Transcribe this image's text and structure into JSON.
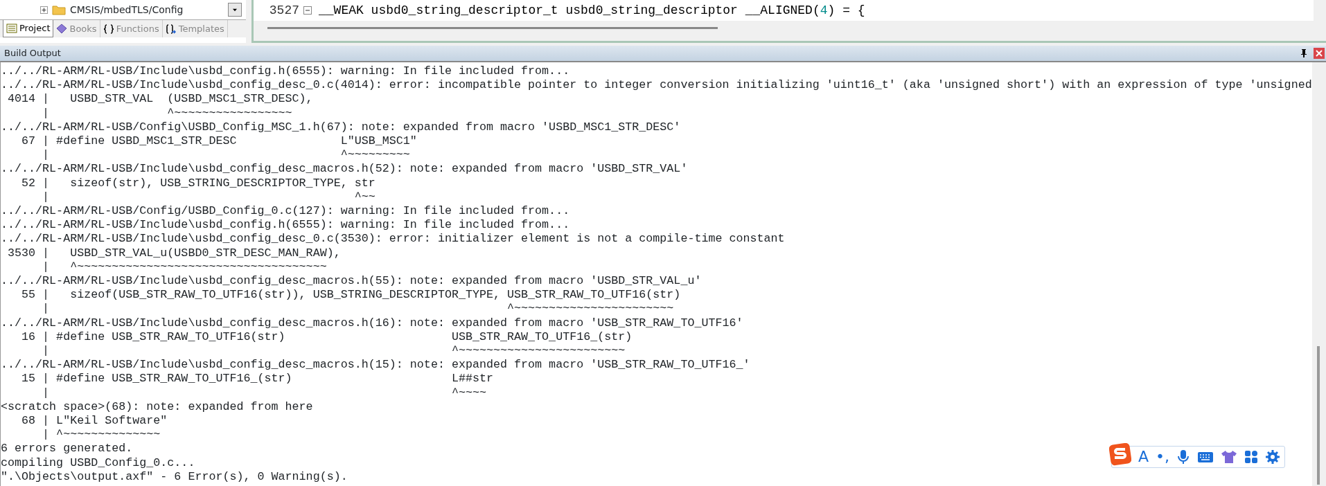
{
  "project_panel": {
    "tree_item": {
      "label": "CMSIS/mbedTLS/Config",
      "expanded": false
    },
    "tabs": [
      {
        "label": "Project",
        "kind": "project",
        "selected": true
      },
      {
        "label": "Books",
        "kind": "books",
        "selected": false
      },
      {
        "label": "Functions",
        "kind": "functions",
        "selected": false
      },
      {
        "label": "Templates",
        "kind": "templates",
        "selected": false
      }
    ]
  },
  "editor": {
    "line_number": "3527",
    "tokens": [
      {
        "text": "__WEAK usbd0_string_descriptor_t usbd0_string_descriptor __ALIGNED(",
        "kind": "plain"
      },
      {
        "text": "4",
        "kind": "number"
      },
      {
        "text": ") = {",
        "kind": "plain"
      }
    ]
  },
  "build_output": {
    "title": "Build Output",
    "lines": [
      "../../RL-ARM/RL-USB/Include\\usbd_config.h(6555): warning: In file included from...",
      "../../RL-ARM/RL-USB/Include\\usbd_config_desc_0.c(4014): error: incompatible pointer to integer conversion initializing 'uint16_t' (aka 'unsigned short') with an expression of type 'unsigned",
      " 4014 |   USBD_STR_VAL  (USBD_MSC1_STR_DESC),",
      "      |                 ^~~~~~~~~~~~~~~~~~",
      "../../RL-ARM/RL-USB/Config\\USBD_Config_MSC_1.h(67): note: expanded from macro 'USBD_MSC1_STR_DESC'",
      "   67 | #define USBD_MSC1_STR_DESC               L\"USB_MSC1\"",
      "      |                                          ^~~~~~~~~~",
      "../../RL-ARM/RL-USB/Include\\usbd_config_desc_macros.h(52): note: expanded from macro 'USBD_STR_VAL'",
      "   52 |   sizeof(str), USB_STRING_DESCRIPTOR_TYPE, str",
      "      |                                            ^~~",
      "../../RL-ARM/RL-USB/Config/USBD_Config_0.c(127): warning: In file included from...",
      "../../RL-ARM/RL-USB/Include\\usbd_config.h(6555): warning: In file included from...",
      "../../RL-ARM/RL-USB/Include\\usbd_config_desc_0.c(3530): error: initializer element is not a compile-time constant",
      " 3530 |   USBD_STR_VAL_u(USBD0_STR_DESC_MAN_RAW),",
      "      |   ^~~~~~~~~~~~~~~~~~~~~~~~~~~~~~~~~~~~~",
      "../../RL-ARM/RL-USB/Include\\usbd_config_desc_macros.h(55): note: expanded from macro 'USBD_STR_VAL_u'",
      "   55 |   sizeof(USB_STR_RAW_TO_UTF16(str)), USB_STRING_DESCRIPTOR_TYPE, USB_STR_RAW_TO_UTF16(str)",
      "      |                                                                  ^~~~~~~~~~~~~~~~~~~~~~~~",
      "../../RL-ARM/RL-USB/Include\\usbd_config_desc_macros.h(16): note: expanded from macro 'USB_STR_RAW_TO_UTF16'",
      "   16 | #define USB_STR_RAW_TO_UTF16(str)                        USB_STR_RAW_TO_UTF16_(str)",
      "      |                                                          ^~~~~~~~~~~~~~~~~~~~~~~~~",
      "../../RL-ARM/RL-USB/Include\\usbd_config_desc_macros.h(15): note: expanded from macro 'USB_STR_RAW_TO_UTF16_'",
      "   15 | #define USB_STR_RAW_TO_UTF16_(str)                       L##str",
      "      |                                                          ^~~~~",
      "<scratch space>(68): note: expanded from here",
      "   68 | L\"Keil Software\"",
      "      | ^~~~~~~~~~~~~~~",
      "6 errors generated.",
      "compiling USBD_Config_0.c...",
      "\".\\Objects\\output.axf\" - 6 Error(s), 0 Warning(s)."
    ]
  },
  "ime_toolbar": {
    "items": [
      {
        "kind": "logo"
      },
      {
        "kind": "text",
        "label": "A"
      },
      {
        "kind": "text",
        "label": "•,"
      },
      {
        "kind": "mic"
      },
      {
        "kind": "keyboard"
      },
      {
        "kind": "shirt"
      },
      {
        "kind": "grid"
      },
      {
        "kind": "gear"
      }
    ]
  }
}
